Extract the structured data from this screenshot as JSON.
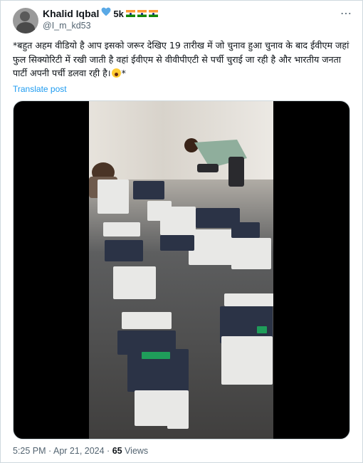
{
  "author": {
    "display_name": "Khalid Iqbal",
    "badge_text": "5k",
    "heart_icon": "blue-heart-icon",
    "flag_icon": "india-flag-icon",
    "handle": "@I_m_kd53"
  },
  "tweet": {
    "text": "*बहुत अहम वीडियो है आप इसको जरूर देखिए 19 तारीख में जो चुनाव हुआ चुनाव के बाद ईवीएम जहां फुल सिक्योरिटी में रखी जाती है वहां ईवीएम से वीवीपीएटी से पर्ची चुराई जा रही है और भारतीय जनता पार्टी अपनी पर्ची डलवा रही है।",
    "text_end": "*",
    "translate_label": "Translate post"
  },
  "meta": {
    "time": "5:25 PM",
    "separator": " · ",
    "date": "Apr 21, 2024",
    "views_count": "65",
    "views_label": " Views"
  },
  "colors": {
    "accent": "#1d9bf0",
    "secondary_text": "#536471",
    "primary_text": "#0f1419"
  }
}
